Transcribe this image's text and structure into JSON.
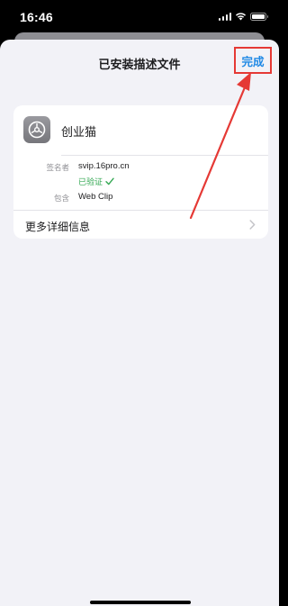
{
  "status_bar": {
    "time": "16:46"
  },
  "sheet": {
    "title": "已安装描述文件",
    "done_label": "完成"
  },
  "profile": {
    "name": "创业猫",
    "details": [
      {
        "label": "签名者",
        "value": "svip.16pro.cn"
      },
      {
        "label": "包含",
        "value": "Web Clip"
      }
    ],
    "verified_text": "已验证"
  },
  "more_details_label": "更多详细信息",
  "colors": {
    "accent": "#1e88e5",
    "highlight_box": "#e53935",
    "verified": "#34a853"
  },
  "icons": [
    "signal-icon",
    "wifi-icon",
    "battery-icon",
    "gear-icon",
    "checkmark-icon",
    "chevron-right-icon",
    "annotation-arrow"
  ]
}
